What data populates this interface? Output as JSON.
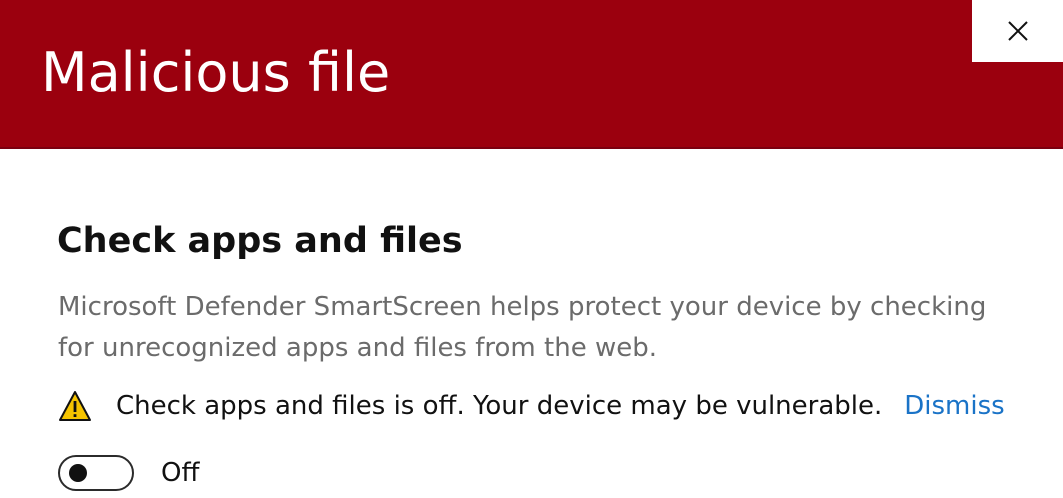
{
  "header": {
    "title": "Malicious file",
    "background_color": "#9b000e",
    "close_icon": "close-icon"
  },
  "section": {
    "title": "Check apps and files",
    "description": "Microsoft Defender SmartScreen helps protect your device by checking for unrecognized apps and files from the web."
  },
  "warning": {
    "icon": "warning-icon",
    "icon_color": "#f5c400",
    "text": "Check apps and files is off. Your device may be vulnerable.",
    "dismiss_label": "Dismiss",
    "link_color": "#1a73c7"
  },
  "toggle": {
    "state": "off",
    "label": "Off"
  }
}
